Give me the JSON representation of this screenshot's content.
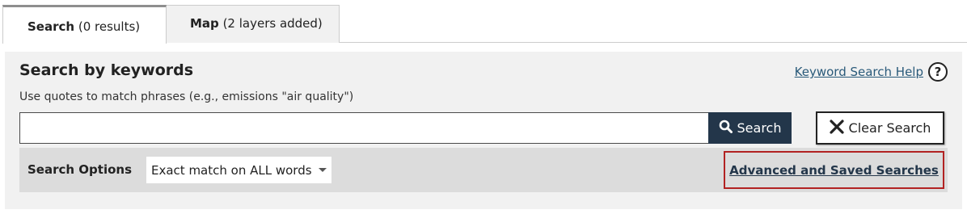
{
  "tabs": [
    {
      "label_bold": "Search",
      "label_rest": " (0 results)",
      "active": true
    },
    {
      "label_bold": "Map",
      "label_rest": " (2 layers added)",
      "active": false
    }
  ],
  "panel": {
    "title": "Search by keywords",
    "help_link": "Keyword Search Help",
    "help_icon": "?",
    "hint": "Use quotes to match phrases (e.g., emissions \"air quality\")"
  },
  "search": {
    "value": "",
    "placeholder": "",
    "button_label": "Search",
    "button_icon": "search-icon"
  },
  "clear": {
    "button_label": "Clear Search",
    "button_icon": "close-icon"
  },
  "options": {
    "label": "Search Options",
    "selected": "Exact match on ALL words",
    "advanced_link": "Advanced and Saved Searches"
  },
  "colors": {
    "panel_bg": "#f1f1f1",
    "options_bg": "#dcdcdc",
    "search_button_bg": "#23364a",
    "highlight_border": "#b22222",
    "link": "#23364a"
  }
}
